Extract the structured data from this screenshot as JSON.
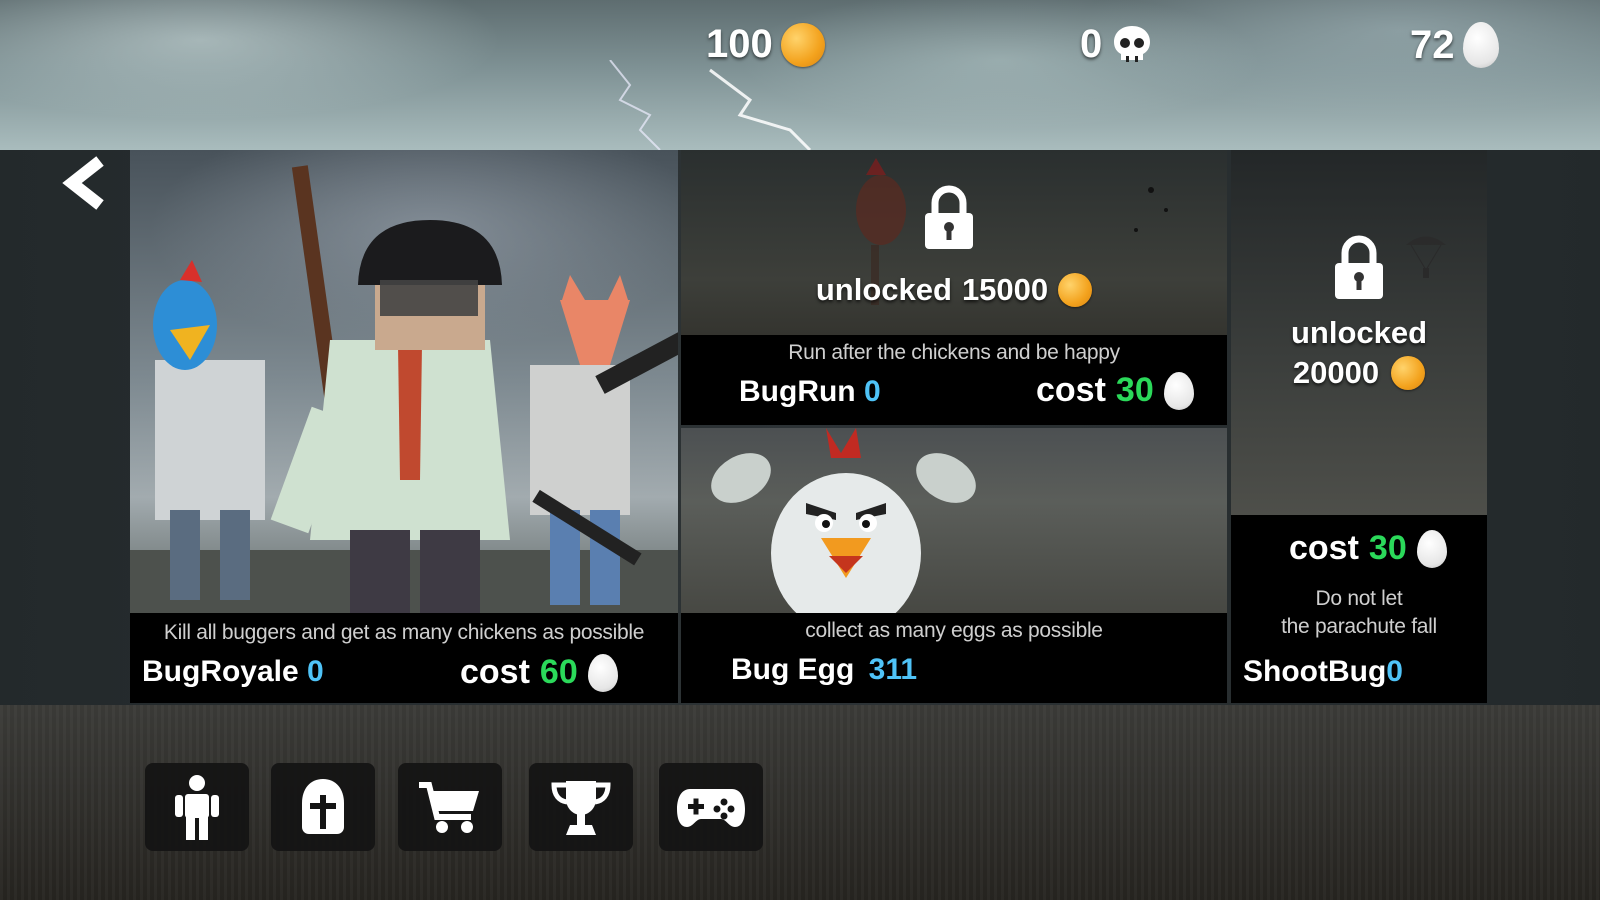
{
  "currency": {
    "coins": "100",
    "kills": "0",
    "eggs": "72"
  },
  "icons": {
    "coin": "coin-icon",
    "skull": "skull-icon",
    "egg": "egg-icon",
    "lock": "lock-icon",
    "back": "back-arrow-icon"
  },
  "colors": {
    "cost_value": "#2bd95a",
    "count_value": "#4fc3f7",
    "coin": "#f3a21d"
  },
  "modes": {
    "bugroyale": {
      "desc": "Kill all buggers and get as many chickens as possible",
      "name": "BugRoyale",
      "count": "0",
      "cost_label": "cost",
      "cost": "60"
    },
    "bugrun": {
      "locked_label": "unlocked",
      "unlock_price": "15000",
      "desc": "Run after the chickens and be happy",
      "name": "BugRun",
      "count": "0",
      "cost_label": "cost",
      "cost": "30"
    },
    "bugegg": {
      "desc": "collect as many eggs as possible",
      "name": "Bug Egg",
      "count": "311"
    },
    "shootbug": {
      "locked_label": "unlocked",
      "unlock_price": "20000",
      "cost_label": "cost",
      "cost": "30",
      "desc_line1": "Do not let",
      "desc_line2": "the parachute fall",
      "name": "ShootBug",
      "count": "0"
    }
  },
  "nav": [
    "character-icon",
    "helmet-icon",
    "cart-icon",
    "trophy-icon",
    "gamepad-icon"
  ]
}
